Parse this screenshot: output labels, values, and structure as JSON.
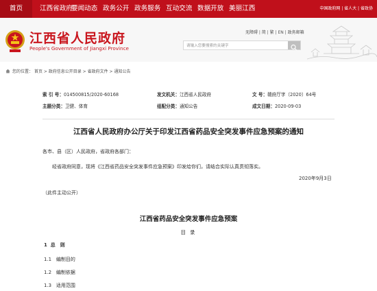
{
  "topnav": {
    "home": "首页",
    "items": [
      "江西省政府",
      "要闻动态",
      "政务公开",
      "政务服务",
      "互动交流",
      "数据开放",
      "美丽江西"
    ],
    "right_links": "中国政府网 | 省人大 | 省政协"
  },
  "header": {
    "site_name": "江西省人民政府",
    "site_name_en": "People's Government of Jiangxi Province",
    "utility_links": "无障碍 | 简 | 繁 | EN | 政务邮箱",
    "search_placeholder": "请输入您要搜索的关键字"
  },
  "breadcrumb": {
    "label": "您的位置：",
    "path": "首页 > 政府信息公开目录 > 省政府文件 > 通知公告"
  },
  "meta": {
    "index_label": "索  引  号：",
    "index_value": "014500815/2020-60168",
    "issuer_label": "发文机关：",
    "issuer_value": "江西省人民政府",
    "docno_label": "文        号：",
    "docno_value": "赣府厅字〔2020〕64号",
    "topic_label": "主题分类：",
    "topic_value": "卫健、体育",
    "genre_label": "组配分类：",
    "genre_value": "通知公告",
    "date_label": "成文日期：",
    "date_value": "2020-09-03"
  },
  "article": {
    "title": "江西省人民政府办公厅关于印发江西省药品安全突发事件应急预案的通知",
    "salutation": "各市、县（区）人民政府，省政府各部门：",
    "body": "经省政府同意，现将《江西省药品安全突发事件应急预案》印发给你们，请结合实际认真贯彻落实。",
    "date": "2020年9月3日",
    "disclosure": "（此件主动公开）",
    "doc_title": "江西省药品安全突发事件应急预案",
    "toc_heading": "目 录",
    "toc": [
      {
        "num": "1",
        "text": "总　则"
      },
      {
        "num": "1.1",
        "text": "编制目的"
      },
      {
        "num": "1.2",
        "text": "编制依据"
      },
      {
        "num": "1.3",
        "text": "适用范围"
      }
    ]
  },
  "colors": {
    "brand_red": "#c0101b",
    "title_red": "#c9161e"
  }
}
